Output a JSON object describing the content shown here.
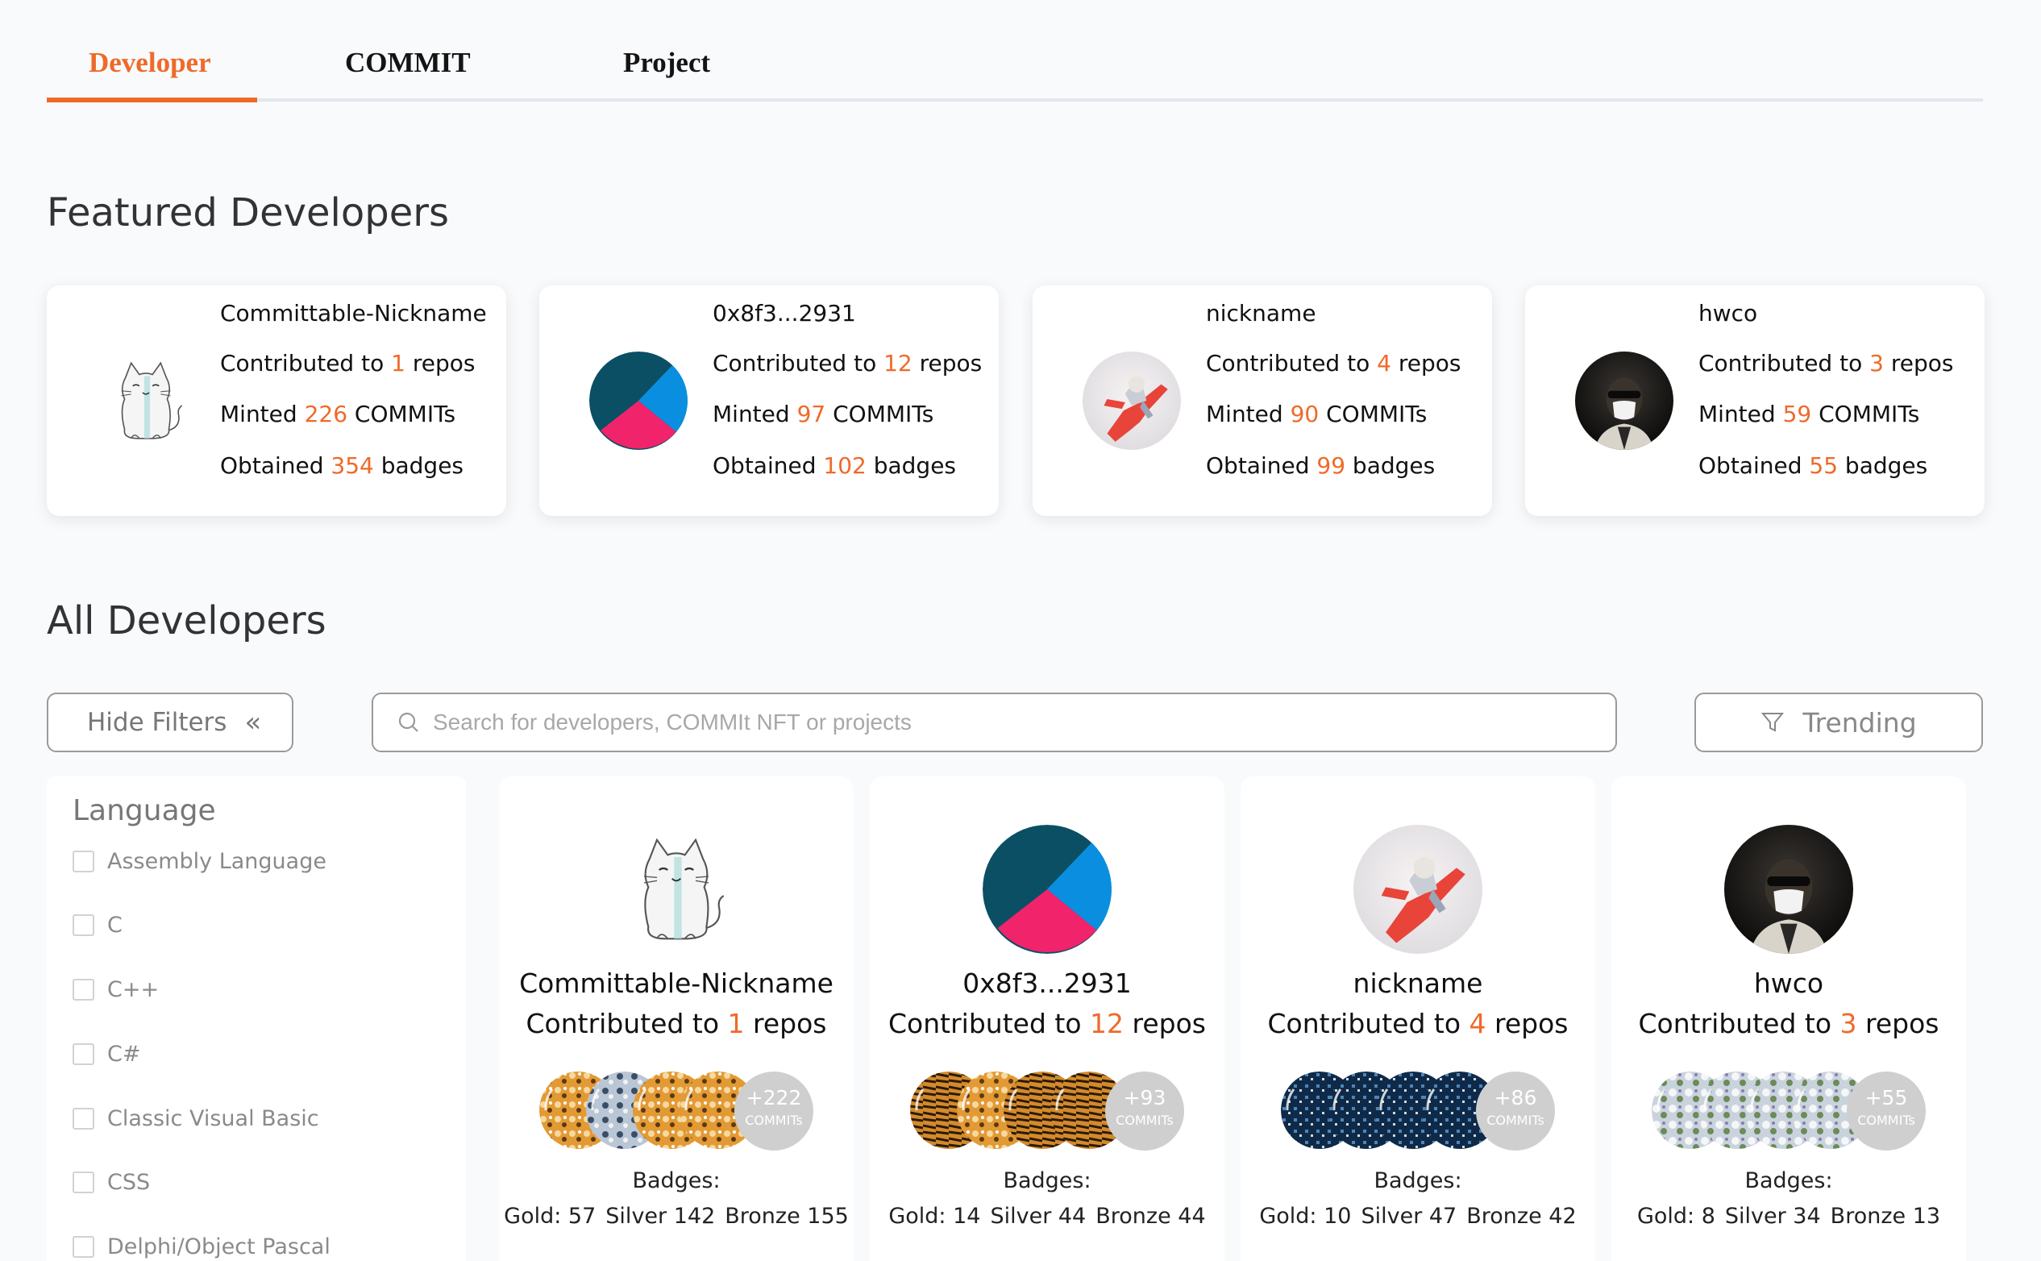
{
  "tabs": [
    {
      "label": "Developer",
      "active": true
    },
    {
      "label": "COMMIT",
      "active": false
    },
    {
      "label": "Project",
      "active": false
    }
  ],
  "colors": {
    "accent": "#ef6a2a",
    "page_bg": "#f9fafc"
  },
  "featured": {
    "title": "Featured Developers",
    "contributed_prefix": "Contributed to ",
    "contributed_suffix": " repos",
    "minted_prefix": "Minted ",
    "minted_suffix": " COMMITs",
    "obtained_prefix": "Obtained ",
    "obtained_suffix": " badges",
    "developers": [
      {
        "name": "Committable-Nickname",
        "repos": "1",
        "commits": "226",
        "badges": "354",
        "avatar": "cat-avatar"
      },
      {
        "name": "0x8f3...2931",
        "repos": "12",
        "commits": "97",
        "badges": "102",
        "avatar": "pie-avatar"
      },
      {
        "name": "nickname",
        "repos": "4",
        "commits": "90",
        "badges": "99",
        "avatar": "figure-avatar"
      },
      {
        "name": "hwco",
        "repos": "3",
        "commits": "59",
        "badges": "55",
        "avatar": "ape-avatar"
      }
    ]
  },
  "all": {
    "title": "All Developers",
    "hide_filters_label": "Hide Filters",
    "search_placeholder": "Search for developers, COMMIt NFT or projects",
    "sort_label": "Trending",
    "filters": {
      "title": "Language",
      "options": [
        "Assembly Language",
        "C",
        "C++",
        "C#",
        "Classic Visual Basic",
        "CSS",
        "Delphi/Object Pascal"
      ]
    },
    "badges_label": "Badges:",
    "commits_unit": "COMMITs",
    "developers": [
      {
        "name": "Committable-Nickname",
        "repos": "1",
        "more": "+222",
        "gold": "Gold: 57",
        "silver": "Silver 142",
        "bronze": "Bronze 155"
      },
      {
        "name": "0x8f3...2931",
        "repos": "12",
        "more": "+93",
        "gold": "Gold: 14",
        "silver": "Silver 44",
        "bronze": "Bronze 44"
      },
      {
        "name": "nickname",
        "repos": "4",
        "more": "+86",
        "gold": "Gold: 10",
        "silver": "Silver 47",
        "bronze": "Bronze 42"
      },
      {
        "name": "hwco",
        "repos": "3",
        "more": "+55",
        "gold": "Gold: 8",
        "silver": "Silver 34",
        "bronze": "Bronze 13"
      }
    ]
  }
}
